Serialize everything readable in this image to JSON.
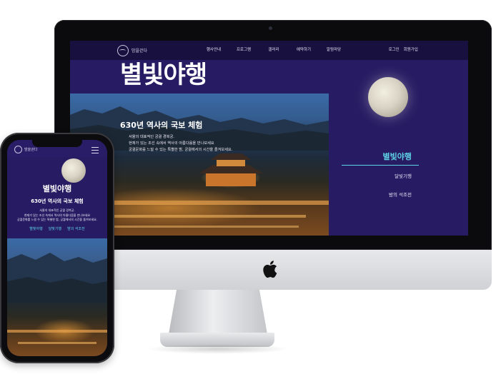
{
  "desktop": {
    "logo_text": "밤을걷다",
    "nav": [
      "행사안내",
      "프로그램",
      "갤러리",
      "예약하기",
      "알림마당"
    ],
    "auth": [
      "로그인",
      "회원가입"
    ],
    "hero_title": "별빛야행",
    "hero_sub": "630년 역사의 국보 체험",
    "hero_desc": [
      "서울의 대표적인 궁궐 경복궁.",
      "현재가 있는 조선 속에서 역사의 아름다움을 만나보세요",
      "궁궐문화를 느낄 수 있는 특별한 밤, 궁궐에서의 시간을 즐겨보세요."
    ],
    "side_menu": [
      "별빛야행",
      "달빛기행",
      "밤의 석조전"
    ]
  },
  "mobile": {
    "logo_text": "밤을걷다",
    "title": "별빛야행",
    "sub": "630년 역사의 국보 체험",
    "desc": [
      "서울의 대표적인 궁궐 경복궁.",
      "현재가 있는 조선 속에서 역사의 아름다움을 만나보세요",
      "궁궐문화를 느낄 수 있는 특별한 밤, 궁궐에서의 시간을 즐겨보세요."
    ],
    "tabs": [
      "별빛야행",
      "달빛기행",
      "밤의 석조전"
    ]
  }
}
